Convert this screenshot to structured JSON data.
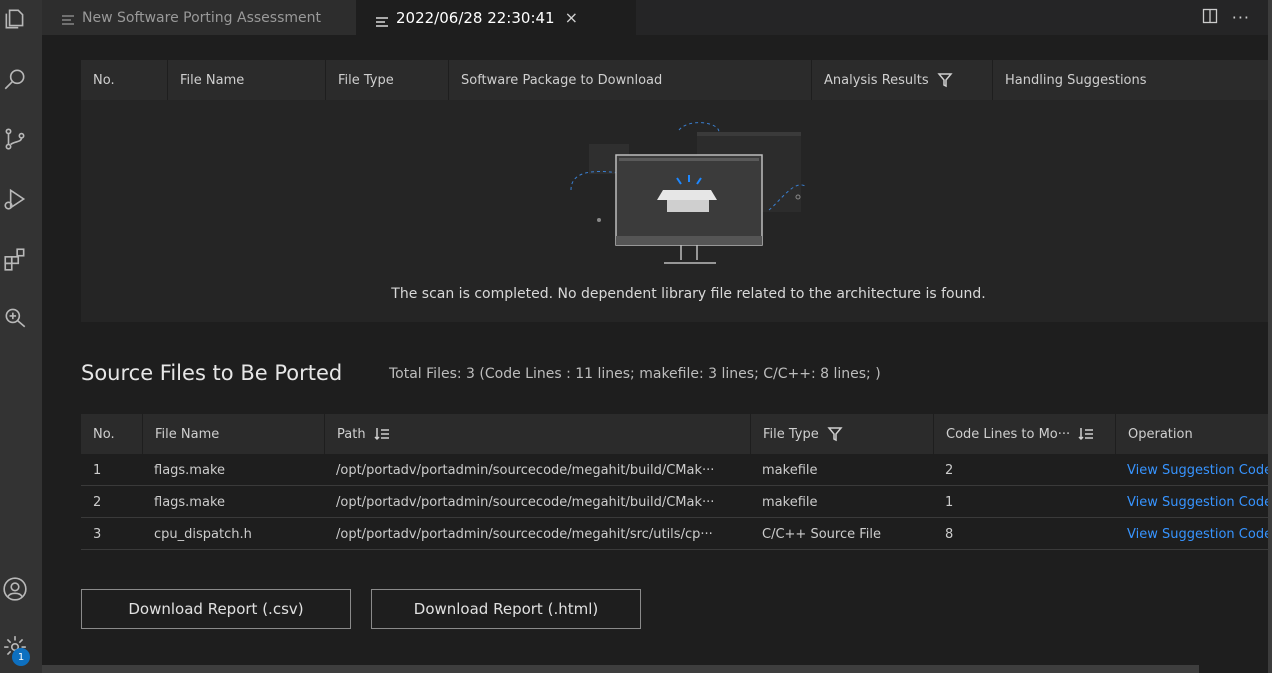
{
  "tabs": [
    {
      "label": "New Software Porting Assessment"
    },
    {
      "label": "2022/06/28 22:30:41",
      "close": "×"
    }
  ],
  "tab_actions": {
    "more": "···"
  },
  "activity_badge": "1",
  "dependency_table": {
    "headers": [
      "No.",
      "File Name",
      "File Type",
      "Software Package to Download",
      "Analysis Results",
      "Handling Suggestions"
    ],
    "empty_message": "The scan is completed. No dependent library file related to the architecture is found."
  },
  "source_section": {
    "title": "Source Files to Be Ported",
    "summary": "Total Files: 3 (Code Lines : 11 lines; makefile: 3 lines; C/C++: 8 lines; )"
  },
  "source_table": {
    "headers": [
      "No.",
      "File Name",
      "Path",
      "File Type",
      "Code Lines to Mo···",
      "Operation"
    ],
    "rows": [
      {
        "no": "1",
        "file": "flags.make",
        "path": "/opt/portadv/portadmin/sourcecode/megahit/build/CMak···",
        "type": "makefile",
        "lines": "2",
        "op": "View Suggestion Code"
      },
      {
        "no": "2",
        "file": "flags.make",
        "path": "/opt/portadv/portadmin/sourcecode/megahit/build/CMak···",
        "type": "makefile",
        "lines": "1",
        "op": "View Suggestion Code"
      },
      {
        "no": "3",
        "file": "cpu_dispatch.h",
        "path": "/opt/portadv/portadmin/sourcecode/megahit/src/utils/cp···",
        "type": "C/C++ Source File",
        "lines": "8",
        "op": "View Suggestion Code"
      }
    ]
  },
  "buttons": {
    "csv": "Download Report (.csv)",
    "html": "Download Report (.html)"
  }
}
